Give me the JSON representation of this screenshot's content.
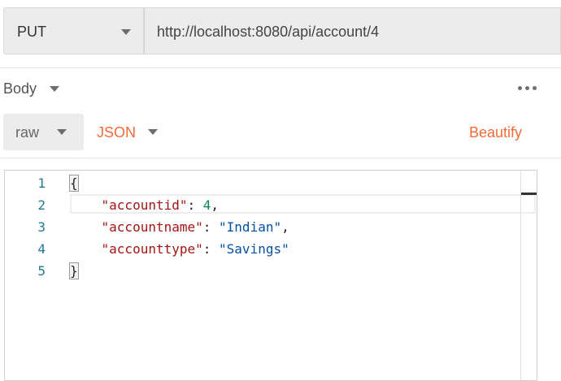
{
  "request": {
    "method": "PUT",
    "url": "http://localhost:8080/api/account/4"
  },
  "body_tab": {
    "label": "Body"
  },
  "body_options": {
    "mode": "raw",
    "format": "JSON",
    "beautify_label": "Beautify"
  },
  "editor": {
    "line_numbers": [
      "1",
      "2",
      "3",
      "4",
      "5"
    ],
    "open_brace": "{",
    "close_brace": "}",
    "fields": [
      {
        "key": "\"accountid\"",
        "value": "4",
        "trail": ","
      },
      {
        "key": "\"accountname\"",
        "value": "\"Indian\"",
        "trail": ","
      },
      {
        "key": "\"accounttype\"",
        "value": "\"Savings\"",
        "trail": ""
      }
    ],
    "colors": {
      "key": "#a31515",
      "number": "#098658",
      "string": "#0451a5",
      "line_number": "#237893"
    }
  },
  "colors": {
    "accent": "#f26b3a",
    "bar_background": "#ececec"
  },
  "icons": {
    "method_dropdown": "chevron-down-icon",
    "body_dropdown": "chevron-down-icon",
    "more": "more-horizontal-icon"
  }
}
